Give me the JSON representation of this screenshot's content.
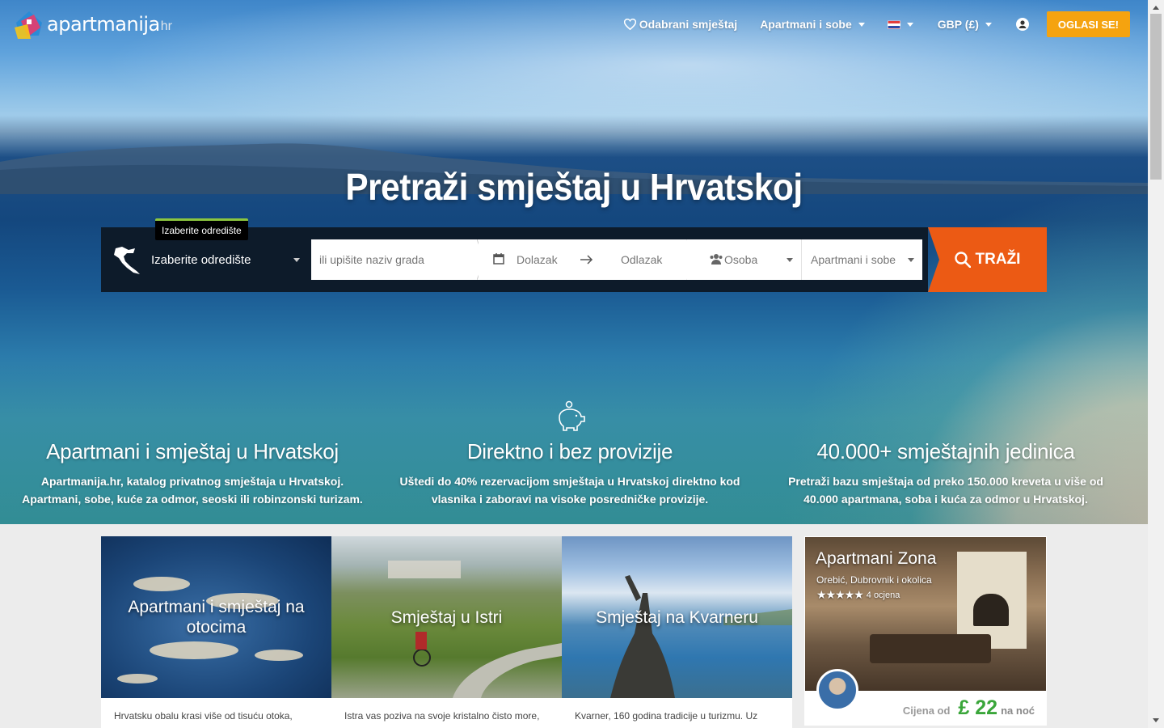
{
  "header": {
    "logo_text": "apartmanija",
    "logo_suffix": "hr",
    "nav": {
      "favorites": "Odabrani smještaj",
      "type": "Apartmani i sobe",
      "currency": "GBP (£)",
      "cta": "OGLASI SE!"
    }
  },
  "hero": {
    "title": "Pretraži smještaj u Hrvatskoj"
  },
  "search": {
    "tooltip": "Izaberite odredište",
    "destination": "Izaberite odredište",
    "city_placeholder": "ili upišite naziv grada",
    "arrival": "Dolazak",
    "departure": "Odlazak",
    "guests": "Osoba",
    "types": "Apartmani i sobe",
    "button": "TRAŽI"
  },
  "features": [
    {
      "title": "Apartmani i smještaj u Hrvatskoj",
      "text_1": "Apartmanija.hr, katalog privatnog smještaja u Hrvatskoj.",
      "text_2": "Apartmani, sobe, kuće za odmor, seoski ili robinzonski turizam."
    },
    {
      "title": "Direktno i bez provizije",
      "text_1": "Uštedi do 40% rezervacijom smještaja u Hrvatskoj direktno kod",
      "text_2": "vlasnika i zaboravi na visoke posredničke provizije."
    },
    {
      "title": "40.000+ smještajnih jedinica",
      "text_1": "Pretraži bazu smještaja od preko 150.000 kreveta u više od",
      "text_2": "40.000 apartmana, soba i kuća za odmor u Hrvatskoj."
    }
  ],
  "cards": [
    {
      "title": "Apartmani i smještaj na otocima",
      "text": "Hrvatsku obalu krasi više od tisuću otoka,"
    },
    {
      "title": "Smještaj u Istri",
      "text": "Istra vas poziva na svoje kristalno čisto more,"
    },
    {
      "title": "Smještaj na Kvarneru",
      "text": "Kvarner, 160 godina tradicije u turizmu. Uz"
    }
  ],
  "featured": {
    "name": "Apartmani Zona",
    "location": "Orebić, Dubrovnik i okolica",
    "stars": "★★★★★",
    "rating_count": 5,
    "reviews": "4 ocjena",
    "price_from": "Cijena od",
    "price": "£ 22",
    "price_unit": "na noć"
  },
  "colors": {
    "cta": "#f5a30f",
    "search_button": "#ec5a14",
    "search_bar": "#0d1b2a",
    "price": "#3aa63a"
  }
}
